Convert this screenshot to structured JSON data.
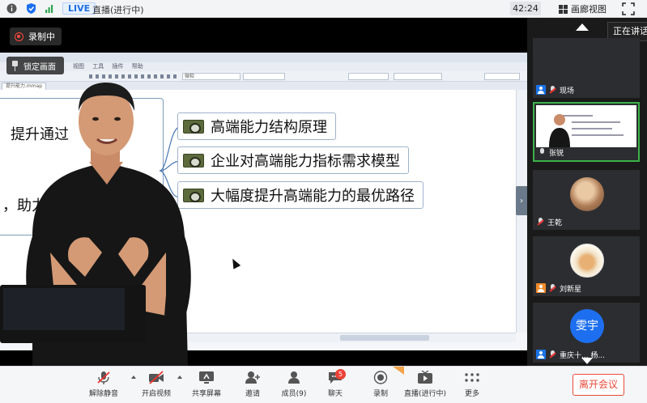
{
  "topbar": {
    "live_badge": "LIVE",
    "live_status": "直播(进行中)",
    "clock": "42:24",
    "layout_label": "画廊视图"
  },
  "stage": {
    "record_label": "录制中",
    "lock_label": "锁定画面",
    "screen": {
      "menu_items": [
        "视图",
        "工具",
        "插件",
        "帮助"
      ],
      "font_field": "微软",
      "tab_label": "提升能力.mmap",
      "topic_lines": [
        "提升通过",
        "，助力"
      ],
      "branches": [
        "高端能力结构原理",
        "企业对高端能力指标需求模型",
        "大幅度提升高端能力的最优路径"
      ]
    }
  },
  "rpanel": {
    "speaking_label": "正在讲话",
    "participants": [
      {
        "name": "现场",
        "role": "host",
        "mic": "muted"
      },
      {
        "name": "张锐",
        "role": "none",
        "mic": "on"
      },
      {
        "name": "王乾",
        "role": "none",
        "mic": "muted"
      },
      {
        "name": "刘新星",
        "role": "guest",
        "mic": "muted"
      },
      {
        "name": "重庆十... 杨...",
        "role": "host",
        "mic": "muted",
        "avatar_text": "雯宇"
      }
    ]
  },
  "toolbar": {
    "buttons": [
      {
        "label": "解除静音",
        "icon": "mic-muted-icon"
      },
      {
        "label": "开启视频",
        "icon": "camera-off-icon"
      },
      {
        "label": "共享屏幕",
        "icon": "share-screen-icon"
      },
      {
        "label": "邀请",
        "icon": "invite-icon"
      },
      {
        "label": "成员(9)",
        "icon": "members-icon"
      },
      {
        "label": "聊天",
        "icon": "chat-icon"
      },
      {
        "label": "录制",
        "icon": "record-icon"
      },
      {
        "label": "直播(进行中)",
        "icon": "live-icon"
      },
      {
        "label": "更多",
        "icon": "more-icon"
      }
    ],
    "chat_badge": "5",
    "leave_label": "离开会议"
  },
  "colors": {
    "accent_blue": "#1d6ff0",
    "record_red": "#ff4a3d",
    "leave_red": "#e84a3a",
    "active_tile": "#3bb24a"
  }
}
